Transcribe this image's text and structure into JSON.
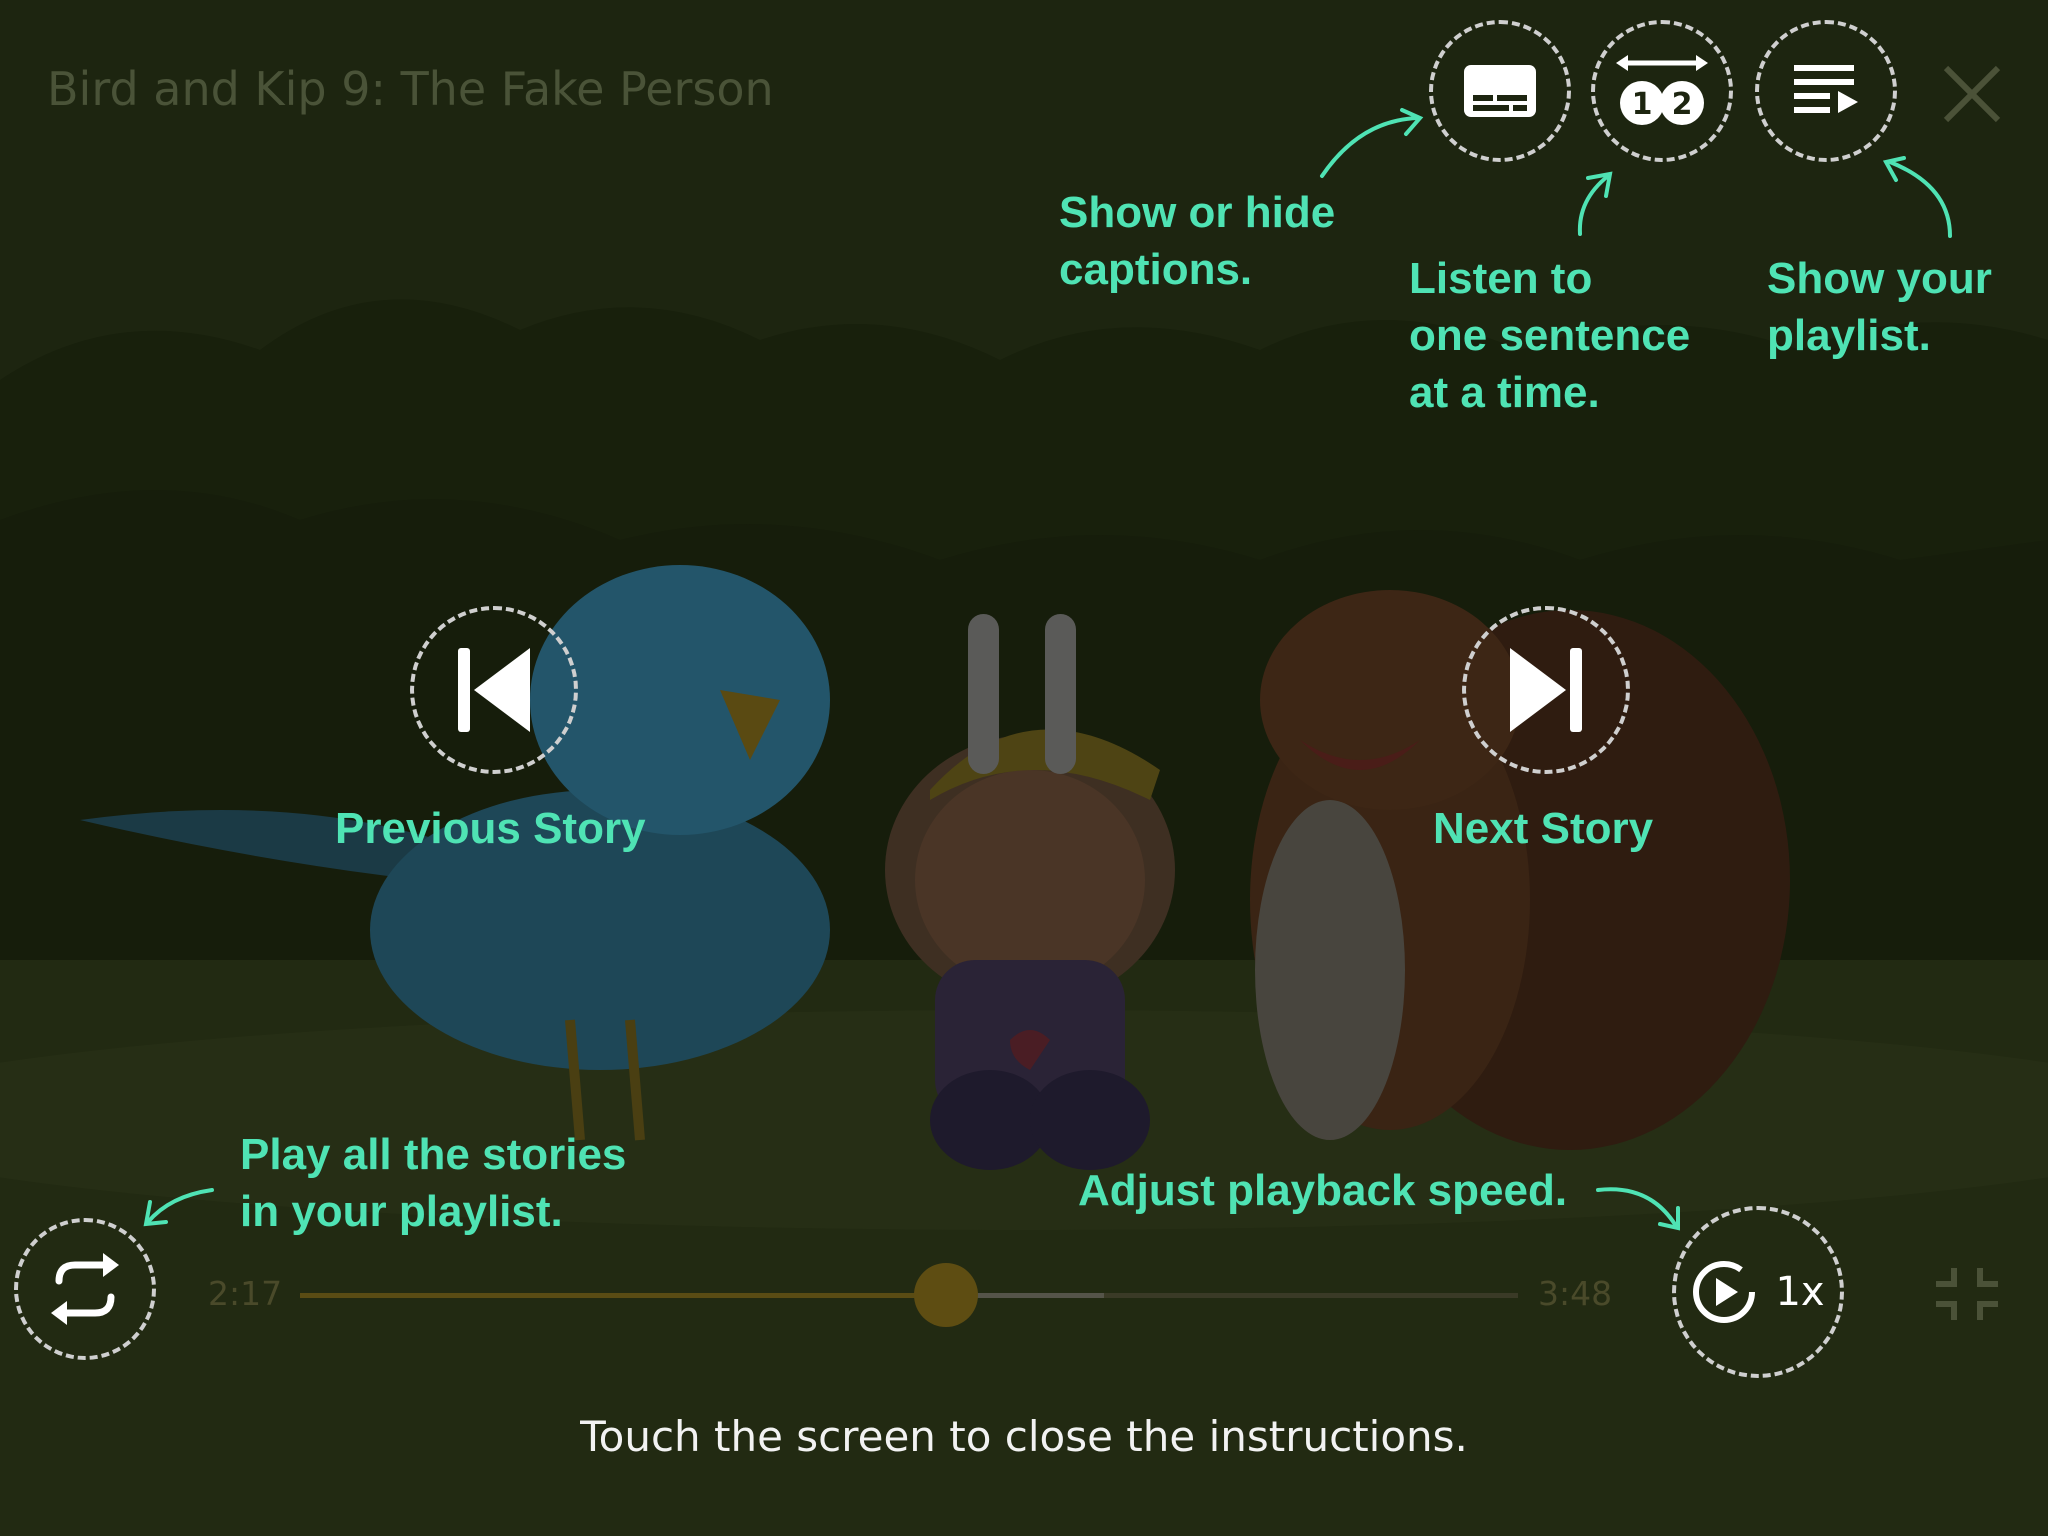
{
  "player": {
    "title": "Bird and Kip 9: The Fake Person",
    "current_time": "2:17",
    "total_time": "3:48",
    "progress": 0.53,
    "buffered": 0.66,
    "speed_label": "1x"
  },
  "tips": {
    "captions": "Show or hide\ncaptions.",
    "sentence": "Listen to\none sentence\nat a time.",
    "playlist": "Show your\nplaylist.",
    "previous": "Previous Story",
    "next": "Next Story",
    "repeat": "Play all the stories\nin your playlist.",
    "speed": "Adjust playback speed."
  },
  "hint": "Touch the screen to close the instructions.",
  "colors": {
    "tip": "#4fe3b4",
    "ring": "#cfcfcf",
    "overlay": "#1d2510"
  },
  "icons": [
    "captions-icon",
    "sentence-mode-icon",
    "playlist-icon",
    "close-icon",
    "previous-icon",
    "pause-icon",
    "next-icon",
    "repeat-icon",
    "speed-icon",
    "exit-fullscreen-icon"
  ]
}
